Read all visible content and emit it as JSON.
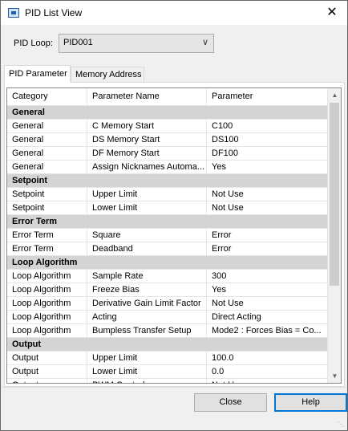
{
  "window": {
    "title": "PID List View",
    "close_glyph": "✕"
  },
  "loop_selector": {
    "label": "PID Loop:",
    "value": "PID001"
  },
  "tabs": [
    {
      "label": "PID Parameter",
      "active": true
    },
    {
      "label": "Memory Address",
      "active": false
    }
  ],
  "grid": {
    "columns": [
      "Category",
      "Parameter Name",
      "Parameter"
    ],
    "rows": [
      {
        "group": "General"
      },
      {
        "category": "General",
        "name": "C Memory Start",
        "value": "C100"
      },
      {
        "category": "General",
        "name": "DS Memory Start",
        "value": "DS100"
      },
      {
        "category": "General",
        "name": "DF Memory Start",
        "value": "DF100"
      },
      {
        "category": "General",
        "name": "Assign Nicknames Automa...",
        "value": "Yes"
      },
      {
        "group": "Setpoint"
      },
      {
        "category": "Setpoint",
        "name": "Upper Limit",
        "value": "Not Use"
      },
      {
        "category": "Setpoint",
        "name": "Lower Limit",
        "value": "Not Use"
      },
      {
        "group": "Error Term"
      },
      {
        "category": "Error Term",
        "name": "Square",
        "value": "Error"
      },
      {
        "category": "Error Term",
        "name": "Deadband",
        "value": "Error"
      },
      {
        "group": "Loop Algorithm"
      },
      {
        "category": "Loop Algorithm",
        "name": "Sample Rate",
        "value": "300"
      },
      {
        "category": "Loop Algorithm",
        "name": "Freeze Bias",
        "value": "Yes"
      },
      {
        "category": "Loop Algorithm",
        "name": "Derivative Gain Limit Factor",
        "value": "Not Use"
      },
      {
        "category": "Loop Algorithm",
        "name": "Acting",
        "value": "Direct Acting"
      },
      {
        "category": "Loop Algorithm",
        "name": "Bumpless Transfer Setup",
        "value": "Mode2 : Forces Bias = Co..."
      },
      {
        "group": "Output"
      },
      {
        "category": "Output",
        "name": "Upper Limit",
        "value": "100.0"
      },
      {
        "category": "Output",
        "name": "Lower Limit",
        "value": "0.0"
      },
      {
        "category": "Output",
        "name": "PWM Control",
        "value": "Not Use"
      }
    ]
  },
  "buttons": {
    "close": "Close",
    "help": "Help"
  },
  "icons": {
    "app": "pid-list-view-icon",
    "dropdown": "chevron-down-icon",
    "scroll_up": "scroll-up-arrow-icon",
    "scroll_down": "scroll-down-arrow-icon"
  }
}
